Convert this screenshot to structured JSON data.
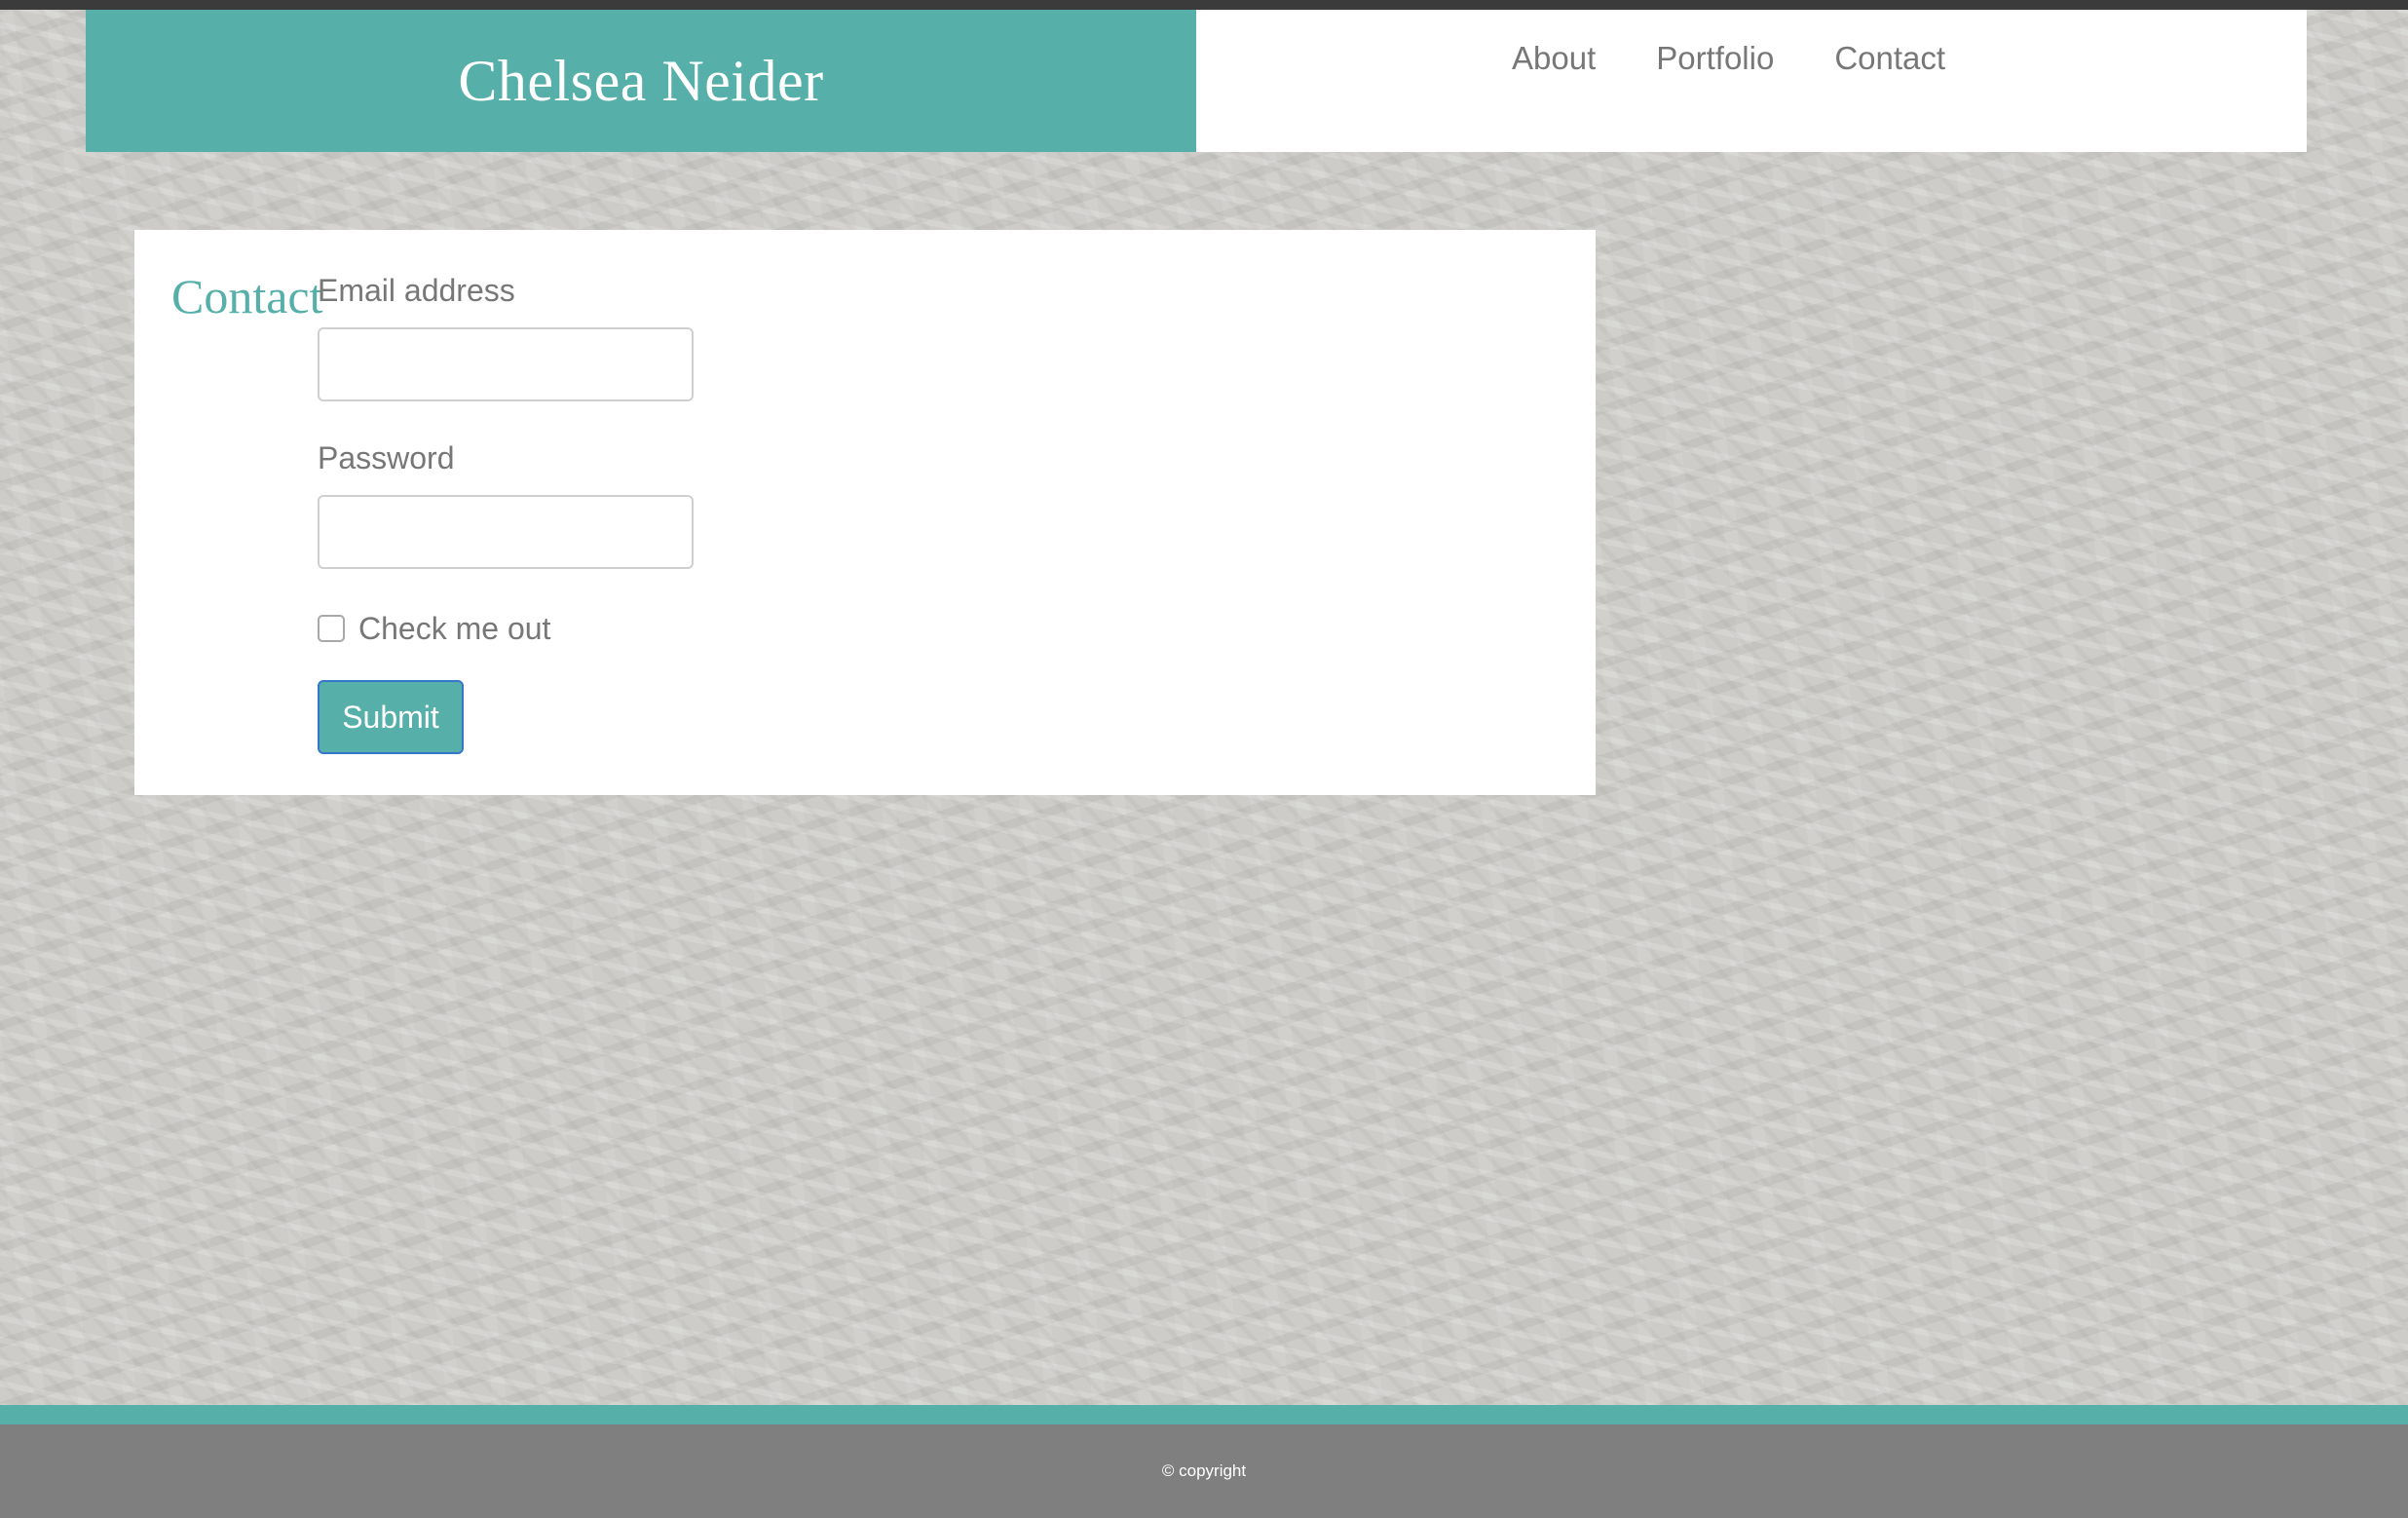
{
  "header": {
    "brand_title": "Chelsea Neider",
    "nav": [
      {
        "label": "About"
      },
      {
        "label": "Portfolio"
      },
      {
        "label": "Contact"
      }
    ]
  },
  "contact": {
    "heading": "Contact",
    "email_label": "Email address",
    "email_value": "",
    "password_label": "Password",
    "password_value": "",
    "checkbox_label": "Check me out",
    "checkbox_checked": false,
    "submit_label": "Submit"
  },
  "footer": {
    "copyright": "© copyright"
  },
  "colors": {
    "accent": "#56b0a9",
    "footer_bg": "#7f7f7f",
    "top_strip": "#3b3b3b",
    "muted_text": "#777777"
  }
}
